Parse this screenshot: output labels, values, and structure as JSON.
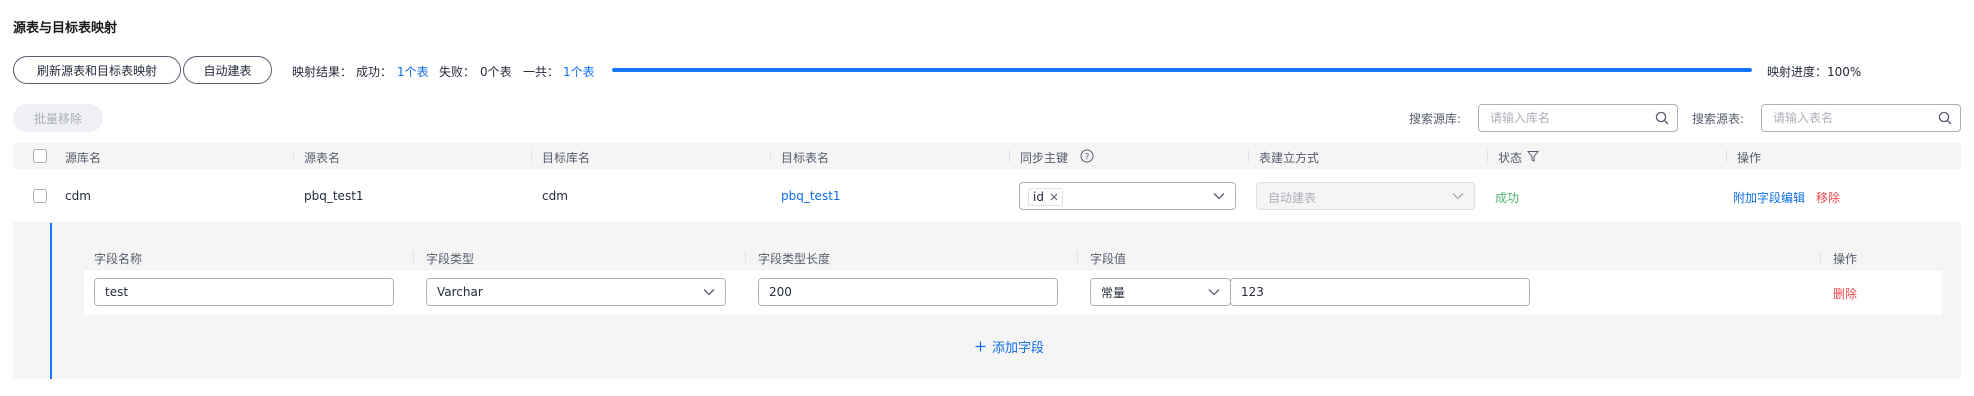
{
  "page_title": "源表与目标表映射",
  "toolbar": {
    "refresh_label": "刷新源表和目标表映射",
    "auto_create_label": "自动建表",
    "result_prefix": "映射结果：",
    "success_label": "成功：",
    "success_value": "1个表",
    "fail_label": "失败：",
    "fail_value": "0个表",
    "total_label": "一共：",
    "total_value": "1个表",
    "progress_label": "映射进度：100%",
    "progress_fraction": 1.0
  },
  "batch_remove_label": "批量移除",
  "search": {
    "source_db_label": "搜索源库:",
    "source_db_placeholder": "请输入库名",
    "source_table_label": "搜索源表:",
    "source_table_placeholder": "请输入表名"
  },
  "table": {
    "headers": {
      "source_db": "源库名",
      "source_table": "源表名",
      "target_db": "目标库名",
      "target_table": "目标表名",
      "sync_pk": "同步主键",
      "create_mode": "表建立方式",
      "status": "状态",
      "actions": "操作"
    },
    "rows": [
      {
        "source_db": "cdm",
        "source_table": "pbq_test1",
        "target_db": "cdm",
        "target_table": "pbq_test1",
        "sync_pk_tag": "id",
        "create_mode": "自动建表",
        "status": "成功",
        "action_edit": "附加字段编辑",
        "action_remove": "移除"
      }
    ]
  },
  "extra_fields": {
    "headers": {
      "name": "字段名称",
      "type": "字段类型",
      "length": "字段类型长度",
      "value": "字段值",
      "actions": "操作"
    },
    "rows": [
      {
        "name": "test",
        "type": "Varchar",
        "length": "200",
        "value_mode": "常量",
        "value": "123",
        "delete": "删除"
      }
    ],
    "add_label": "添加字段"
  },
  "colors": {
    "accent": "#1476ff",
    "link": "#0d6ee8",
    "success": "#50b371",
    "danger": "#e84a4a"
  }
}
